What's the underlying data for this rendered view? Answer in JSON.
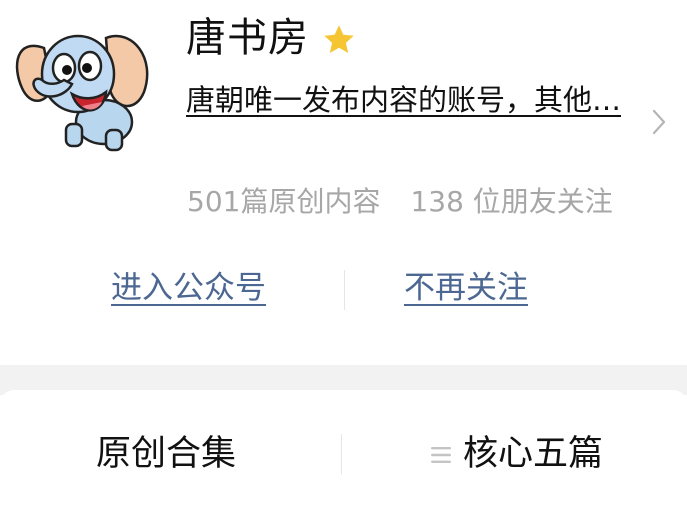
{
  "profile": {
    "avatar_icon": "cartoon-elephant-avatar",
    "name": "唐书房",
    "star_icon": "star-icon",
    "star_color": "#f6c533",
    "description": "唐朝唯一发布内容的账号，其他…",
    "chevron_icon": "chevron-right-icon",
    "stats": {
      "original_count": "501篇原创内容",
      "followers": "138 位朋友关注"
    },
    "actions": {
      "enter_label": "进入公众号",
      "unfollow_label": "不再关注"
    },
    "link_color": "#4c6792"
  },
  "collections": {
    "tabs": [
      {
        "label": "原创合集"
      },
      {
        "label": "核心五篇",
        "icon": "list-icon"
      }
    ]
  }
}
